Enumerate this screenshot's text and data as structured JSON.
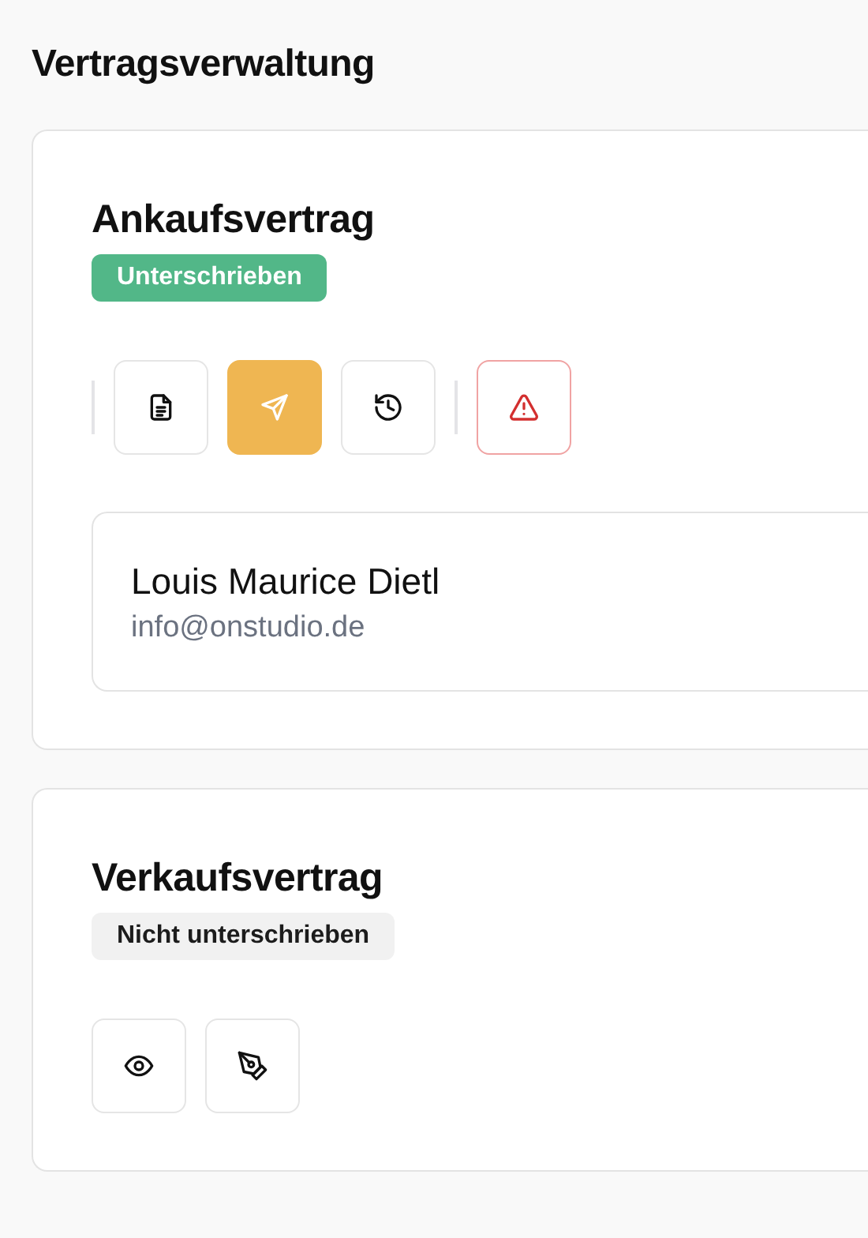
{
  "page_title": "Vertragsverwaltung",
  "contracts": [
    {
      "title": "Ankaufsvertrag",
      "status": {
        "label": "Unterschrieben",
        "signed": true
      },
      "actions": [
        {
          "kind": "divider"
        },
        {
          "kind": "document",
          "active": false
        },
        {
          "kind": "send",
          "active": true
        },
        {
          "kind": "history",
          "active": false
        },
        {
          "kind": "divider"
        },
        {
          "kind": "warning",
          "active": false
        }
      ],
      "party": {
        "name": "Louis Maurice Dietl",
        "email": "info@onstudio.de"
      }
    },
    {
      "title": "Verkaufsvertrag",
      "status": {
        "label": "Nicht unterschrieben",
        "signed": false
      },
      "actions": [
        {
          "kind": "eye",
          "active": false
        },
        {
          "kind": "pen",
          "active": false
        }
      ]
    }
  ]
}
